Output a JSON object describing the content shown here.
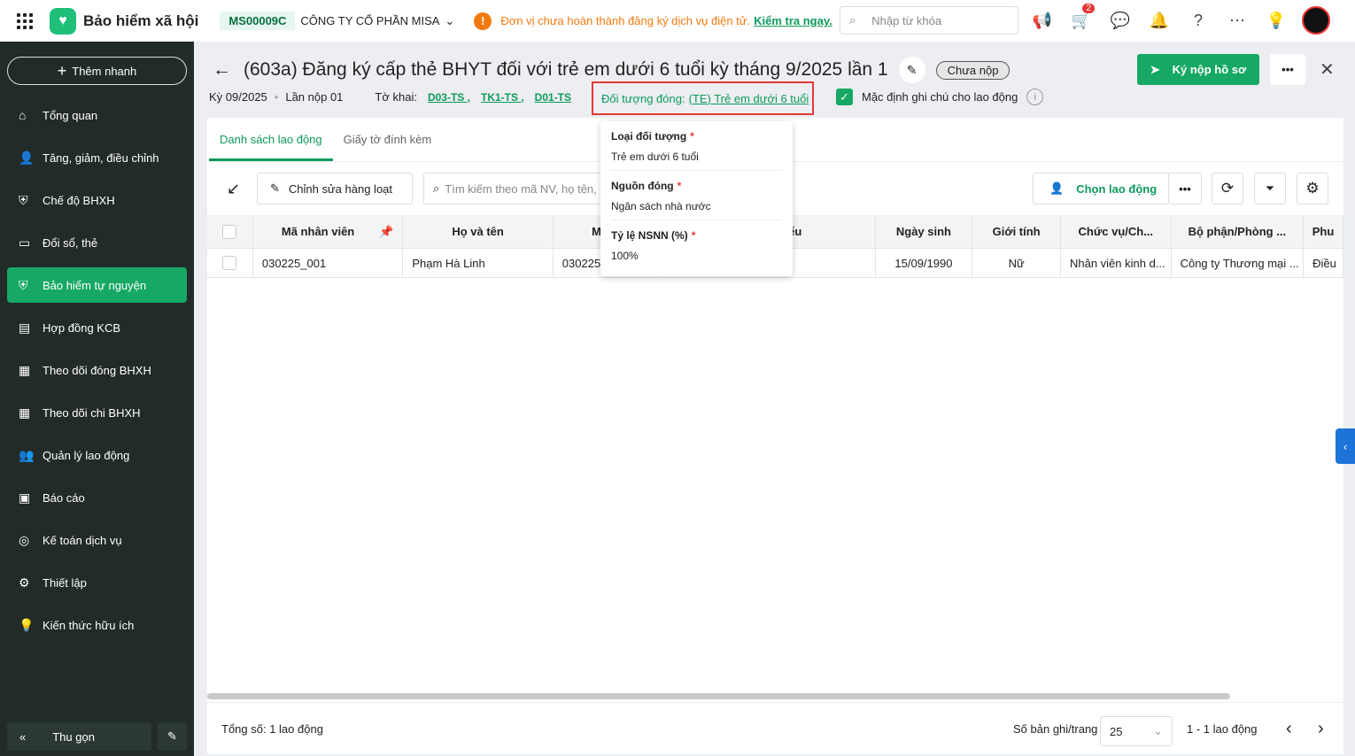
{
  "header": {
    "app_name": "Bảo hiểm xã hội",
    "company_code": "MS00009C",
    "company_name": "CÔNG TY CỔ PHẦN MISA",
    "warning_text": "Đơn vị chưa hoàn thành đăng ký dịch vụ điện tử.",
    "warning_link": "Kiểm tra ngay.",
    "search_placeholder": "Nhập từ khóa",
    "cart_badge": "2"
  },
  "sidebar": {
    "quick_add": "Thêm nhanh",
    "items": [
      {
        "label": "Tổng quan",
        "icon": "home-icon"
      },
      {
        "label": "Tăng, giảm, điều chỉnh",
        "icon": "user-icon"
      },
      {
        "label": "Chế độ BHXH",
        "icon": "shield-icon"
      },
      {
        "label": "Đổi sổ, thẻ",
        "icon": "card-icon"
      },
      {
        "label": "Bảo hiểm tự nguyện",
        "icon": "shield-icon",
        "active": true
      },
      {
        "label": "Hợp đồng KCB",
        "icon": "contract-icon"
      },
      {
        "label": "Theo dõi đóng BHXH",
        "icon": "doc-icon"
      },
      {
        "label": "Theo dõi chi BHXH",
        "icon": "doc-icon"
      },
      {
        "label": "Quản lý lao động",
        "icon": "users-icon"
      },
      {
        "label": "Báo cáo",
        "icon": "report-icon"
      },
      {
        "label": "Kế toán dịch vụ",
        "icon": "compass-icon"
      },
      {
        "label": "Thiết lập",
        "icon": "gear-icon"
      },
      {
        "label": "Kiến thức hữu ích",
        "icon": "bulb-icon"
      }
    ],
    "collapse": "Thu gọn"
  },
  "page": {
    "title": "(603a) Đăng ký cấp thẻ BHYT đối với trẻ em dưới 6 tuổi kỳ tháng 9/2025 lần 1",
    "status": "Chưa nộp",
    "period": "Kỳ 09/2025",
    "submission": "Lần nộp 01",
    "forms_label": "Tờ khai:",
    "forms": [
      "D03-TS ,",
      "TK1-TS ,",
      "D01-TS"
    ],
    "object_label": "Đối tượng đóng:",
    "object_value": "(TE) Trẻ em dưới 6 tuổi",
    "default_note": "Mặc định ghi chú cho lao động",
    "submit": "Ký nộp hồ sơ"
  },
  "tabs": [
    "Danh sách lao động",
    "Giấy tờ đính kèm"
  ],
  "toolbar": {
    "bulk_edit": "Chỉnh sửa hàng loạt",
    "search_placeholder": "Tìm kiếm theo mã NV, họ tên,",
    "choose": "Chọn lao động"
  },
  "table": {
    "columns": [
      "Mã nhân viên",
      "Họ và tên",
      "Mã số",
      "Số hộ chiếu",
      "Ngày sinh",
      "Giới tính",
      "Chức vụ/Ch...",
      "Bộ phận/Phòng ...",
      "Phu"
    ],
    "rows": [
      [
        "030225_001",
        "Phạm Hà Linh",
        "030225",
        "",
        "15/09/1990",
        "Nữ",
        "Nhân viên kinh d...",
        "Công ty Thương mại ...",
        "Điều"
      ]
    ]
  },
  "popover": [
    {
      "label": "Loại đối tượng",
      "value": "Trẻ em dưới 6 tuổi"
    },
    {
      "label": "Nguồn đóng",
      "value": "Ngân sách nhà nước"
    },
    {
      "label": "Tỷ lệ NSNN (%)",
      "value": "100%"
    }
  ],
  "footer": {
    "total": "Tổng số: 1 lao động",
    "per_page_label": "Số bản ghi/trang",
    "per_page": "25",
    "range": "1 - 1 lao động"
  },
  "colors": {
    "accent": "#16a864",
    "sidebar": "#212b28",
    "warning": "#f07a10",
    "highlight": "#e53935"
  }
}
